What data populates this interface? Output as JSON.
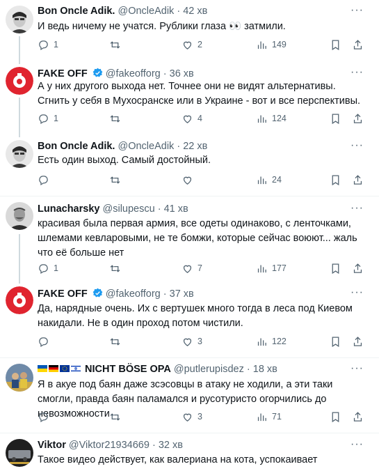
{
  "tweets": [
    {
      "name": "Bon Oncle Adik.",
      "handle": "@OncleAdik",
      "sep": "·",
      "time": "42 хв",
      "text": "И ведь ничему не учатся. Рублики глаза 👀 затмили.",
      "replies": "1",
      "retweets": "",
      "likes": "2",
      "views": "149",
      "verified": false
    },
    {
      "name": "FAKE OFF",
      "handle": "@fakeofforg",
      "sep": "·",
      "time": "36 хв",
      "text": "А у них другого выхода нет. Точнее они не видят альтернативы. Сгнить у себя в Мухосранске или в Украине - вот и все перспективы.",
      "replies": "1",
      "retweets": "",
      "likes": "4",
      "views": "124",
      "verified": true
    },
    {
      "name": "Bon Oncle Adik.",
      "handle": "@OncleAdik",
      "sep": "·",
      "time": "22 хв",
      "text": "Есть один выход. Самый достойный.",
      "replies": "",
      "retweets": "",
      "likes": "",
      "views": "24",
      "verified": false
    },
    {
      "name": "Lunacharsky",
      "handle": "@silupescu",
      "sep": "·",
      "time": "41 хв",
      "text": "красивая была первая армия, все одеты одинаково, с ленточками, шлемами кевларовыми, не те бомжи, которые сейчас воюют... жаль что её больше нет",
      "replies": "1",
      "retweets": "",
      "likes": "7",
      "views": "177",
      "verified": false
    },
    {
      "name": "FAKE OFF",
      "handle": "@fakeofforg",
      "sep": "·",
      "time": "37 хв",
      "text": "Да, нарядные очень. Их с вертушек много тогда в леса под Киевом накидали. Не в один проход потом чистили.",
      "replies": "",
      "retweets": "",
      "likes": "3",
      "views": "122",
      "verified": true
    },
    {
      "name": "NICHT BÖSE OPA",
      "handle": "@putlerupisdez",
      "sep": "·",
      "time": "18 хв",
      "text": "Я в акуе под баян даже зсэсовцы в атаку не ходили, а эти таки смогли, правда баян паламался и русотуристо огорчились до невозможности",
      "replies": "",
      "retweets": "",
      "likes": "3",
      "views": "71",
      "verified": false
    },
    {
      "name": "Viktor",
      "handle": "@Viktor21934669",
      "sep": "·",
      "time": "32 хв",
      "text": "Такое видео действует, как валериана на кота, успокаивает",
      "replies": "",
      "retweets": "",
      "likes": "",
      "views": "",
      "verified": false
    }
  ],
  "more_label": "···",
  "icons": [
    "reply-icon",
    "retweet-icon",
    "like-icon",
    "views-icon",
    "bookmark-icon",
    "share-icon"
  ],
  "colors": {
    "verified": "#1d9bf0",
    "muted": "#536471",
    "fakeoff_red": "#e0242f"
  }
}
